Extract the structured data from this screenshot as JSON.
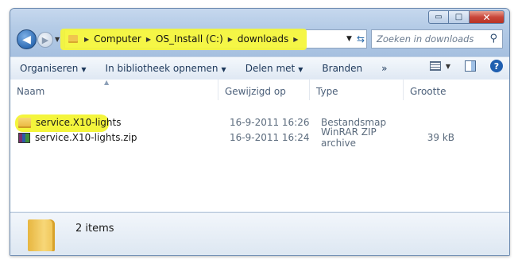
{
  "window": {
    "caption_buttons": {
      "minimize": "▭",
      "maximize": "□",
      "close": "✕"
    }
  },
  "nav": {
    "back_glyph": "◀",
    "forward_glyph": "▶",
    "breadcrumbs": [
      "Computer",
      "OS_Install (C:)",
      "downloads"
    ],
    "search_placeholder": "Zoeken in downloads"
  },
  "toolbar": {
    "organize": "Organiseren",
    "include_library": "In bibliotheek opnemen",
    "share_with": "Delen met",
    "burn": "Branden",
    "more": "»"
  },
  "columns": [
    "Naam",
    "Gewijzigd op",
    "Type",
    "Grootte"
  ],
  "files": [
    {
      "name": "service.X10-lights",
      "modified": "16-9-2011 16:26",
      "type": "Bestandsmap",
      "size": "",
      "icon": "folder-icon",
      "highlighted": true
    },
    {
      "name": "service.X10-lights.zip",
      "modified": "16-9-2011 16:24",
      "type": "WinRAR ZIP archive",
      "size": "39 kB",
      "icon": "winrar-archive-icon",
      "highlighted": false
    }
  ],
  "details": {
    "item_count": "2 items"
  },
  "colors": {
    "highlight": "#f4f53c",
    "chrome": "#b4cbe6",
    "close_red": "#c9463a"
  }
}
